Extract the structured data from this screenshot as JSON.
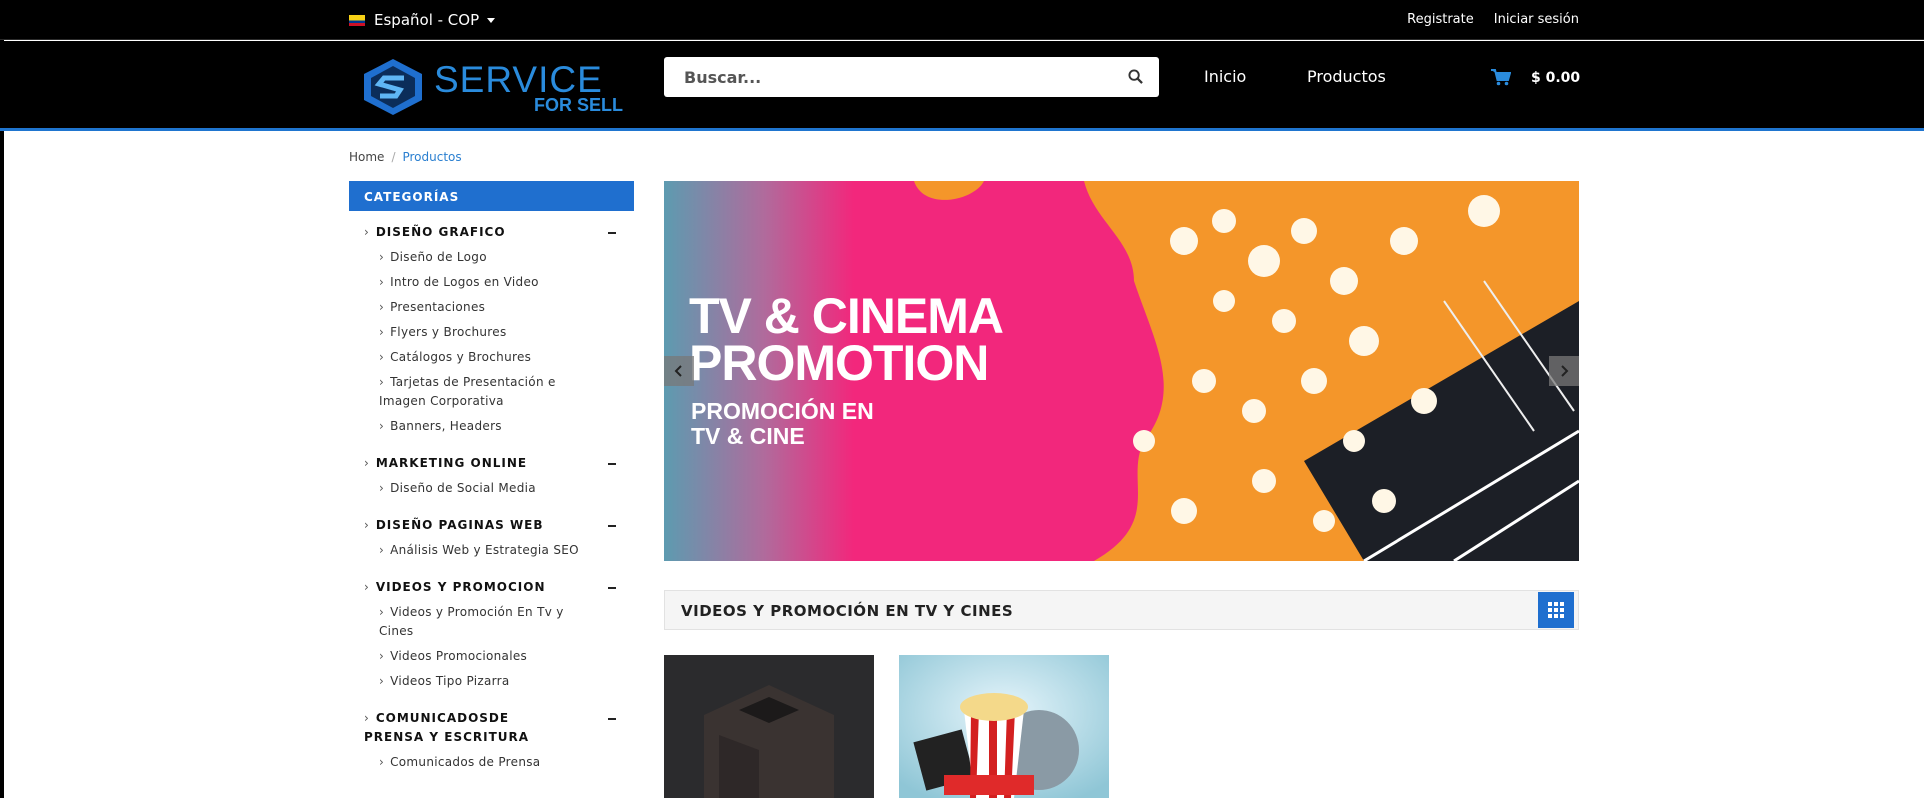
{
  "topbar": {
    "language": "Español - COP",
    "register": "Registrate",
    "login": "Iniciar sesión"
  },
  "header": {
    "logo_line1": "SERVICE",
    "logo_line2": "FOR SELL",
    "search_placeholder": "Buscar...",
    "nav": [
      "Inicio",
      "Productos"
    ],
    "cart_total": "$ 0.00",
    "accent": "#1f6fcf"
  },
  "breadcrumb": {
    "home": "Home",
    "current": "Productos"
  },
  "sidebar": {
    "heading": "CATEGORÍAS",
    "groups": [
      {
        "title": "DISEÑO GRAFICO",
        "items": [
          "Diseño de Logo",
          "Intro de Logos en Video",
          "Presentaciones",
          "Flyers y Brochures",
          "Catálogos y Brochures",
          "Tarjetas de Presentación e Imagen Corporativa",
          "Banners, Headers"
        ]
      },
      {
        "title": "MARKETING ONLINE",
        "items": [
          "Diseño de Social Media"
        ]
      },
      {
        "title": "DISEÑO PAGINAS WEB",
        "items": [
          "Análisis Web y Estrategia SEO"
        ]
      },
      {
        "title": "VIDEOS Y PROMOCION",
        "items": [
          "Videos y Promoción En Tv y Cines",
          "Videos Promocionales",
          "Videos Tipo Pizarra"
        ]
      },
      {
        "title": "COMUNICADOSDE PRENSA Y ESCRITURA",
        "items": [
          "Comunicados de Prensa"
        ]
      }
    ]
  },
  "banner": {
    "title_line1": "TV & CINEMA",
    "title_line2": "PROMOTION",
    "subtitle_line1": "PROMOCIÓN EN",
    "subtitle_line2": "TV & CINE"
  },
  "section": {
    "title": "VIDEOS Y PROMOCIÓN EN TV Y CINES"
  }
}
